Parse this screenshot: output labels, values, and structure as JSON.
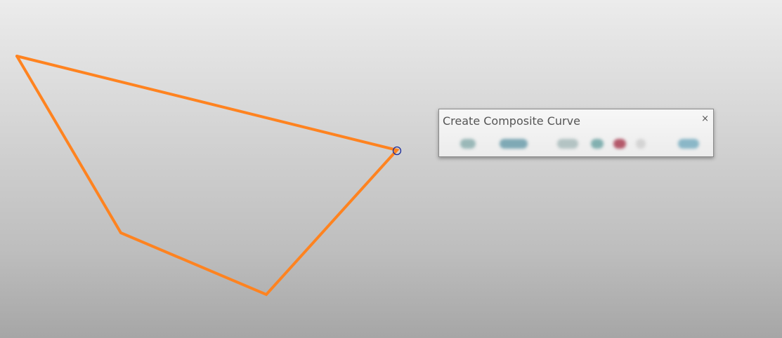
{
  "canvas": {
    "curve_color": "#ff8320",
    "endpoint_marker_color": "#1a2c9c"
  },
  "panel": {
    "title": "Create Composite Curve",
    "close_label": "×"
  },
  "toolbar": {
    "tools": [
      {
        "name": "tool-select-icon",
        "color": "#9ab8b8"
      },
      {
        "name": "tool-chain-icon",
        "color": "#7fa9b5"
      },
      {
        "name": "tool-line-icon",
        "color": "#b3c3c3"
      },
      {
        "name": "tool-arc-icon",
        "color": "#82b0b0"
      },
      {
        "name": "tool-cancel-icon",
        "color": "#b45a6b"
      },
      {
        "name": "tool-separator-icon",
        "color": "#d4d4d4"
      },
      {
        "name": "tool-accept-icon",
        "color": "#8ab7c7"
      }
    ]
  }
}
